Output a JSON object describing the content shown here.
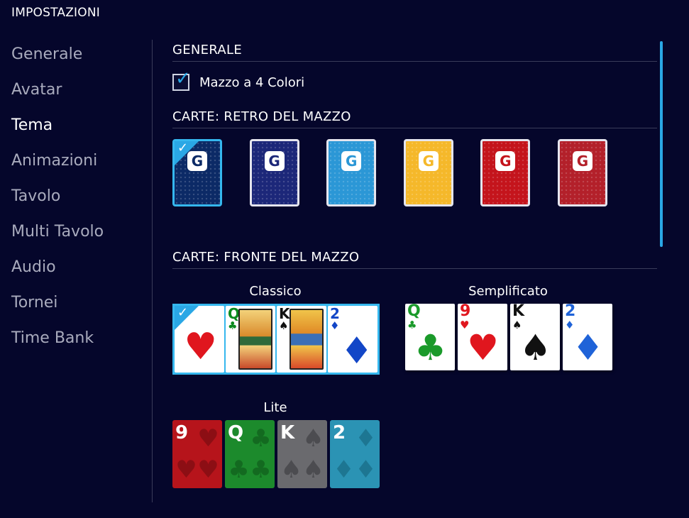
{
  "title": "IMPOSTAZIONI",
  "sidebar": {
    "items": [
      {
        "label": "Generale",
        "active": false
      },
      {
        "label": "Avatar",
        "active": false
      },
      {
        "label": "Tema",
        "active": true
      },
      {
        "label": "Animazioni",
        "active": false
      },
      {
        "label": "Tavolo",
        "active": false
      },
      {
        "label": "Multi Tavolo",
        "active": false
      },
      {
        "label": "Audio",
        "active": false
      },
      {
        "label": "Tornei",
        "active": false
      },
      {
        "label": "Time Bank",
        "active": false
      }
    ]
  },
  "sections": {
    "generale": "GENERALE",
    "retro": "CARTE: RETRO DEL MAZZO",
    "fronte": "CARTE: FRONTE DEL MAZZO"
  },
  "four_color": {
    "label": "Mazzo a 4 Colori",
    "checked": true
  },
  "card_backs": [
    {
      "color": "#0c2a66",
      "logo_color": "#0c2a66",
      "selected": true
    },
    {
      "color": "#1c2779",
      "logo_color": "#1c2779",
      "selected": false
    },
    {
      "color": "#2b97d6",
      "logo_color": "#2b97d6",
      "selected": false
    },
    {
      "color": "#f5b82a",
      "logo_color": "#f5b82a",
      "selected": false
    },
    {
      "color": "#c4141c",
      "logo_color": "#c4141c",
      "selected": false
    },
    {
      "color": "#b3202a",
      "logo_color": "#b3202a",
      "selected": false
    }
  ],
  "decks": {
    "classico": {
      "label": "Classico",
      "selected": true,
      "cards": [
        {
          "rank": "",
          "suit": "♥",
          "color": "#e0161e",
          "court": false
        },
        {
          "rank": "Q",
          "suit": "♣",
          "color": "#0a8a1e",
          "court": true
        },
        {
          "rank": "K",
          "suit": "♠",
          "color": "#111111",
          "court": true
        },
        {
          "rank": "2",
          "suit": "♦",
          "color": "#1246c7",
          "court": false
        }
      ]
    },
    "semplificato": {
      "label": "Semplificato",
      "cards": [
        {
          "rank": "Q",
          "suit": "♣",
          "color": "#1a9a2a"
        },
        {
          "rank": "9",
          "suit": "♥",
          "color": "#e0161e"
        },
        {
          "rank": "K",
          "suit": "♠",
          "color": "#111111"
        },
        {
          "rank": "2",
          "suit": "♦",
          "color": "#1f63d8"
        }
      ]
    },
    "lite": {
      "label": "Lite",
      "cards": [
        {
          "rank": "9",
          "suit": "♥",
          "bg": "#b6141b",
          "pip": "#8c0e14"
        },
        {
          "rank": "Q",
          "suit": "♣",
          "bg": "#1c8a2c",
          "pip": "#136a20"
        },
        {
          "rank": "K",
          "suit": "♠",
          "bg": "#6a6a6e",
          "pip": "#4c4c50"
        },
        {
          "rank": "2",
          "suit": "♦",
          "bg": "#2b93b4",
          "pip": "#1d7692"
        }
      ]
    }
  }
}
